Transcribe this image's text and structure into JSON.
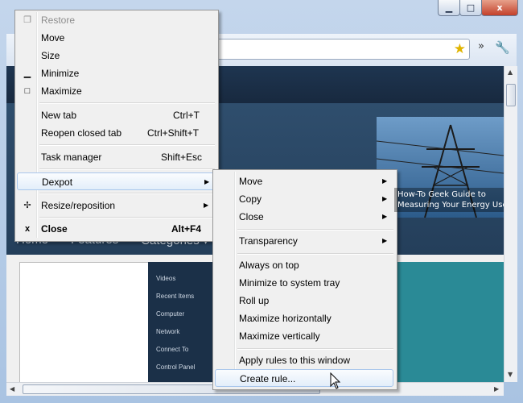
{
  "window_controls": {
    "minimize": "▁",
    "maximize": "□",
    "close": "x"
  },
  "toolbar": {
    "star": "★",
    "extensions": "»",
    "wrench": "🔧"
  },
  "site": {
    "banner_text": "How-To Geek Guide to Measuring Your Energy Use",
    "nav": [
      "Home",
      "Features",
      "Categories ▾"
    ],
    "sidebar_items": [
      "Videos",
      "Recent Items",
      "Computer",
      "Network",
      "Connect To",
      "Control Panel"
    ]
  },
  "system_menu": [
    {
      "label": "Restore",
      "shortcut": "",
      "icon": "❐",
      "disabled": true
    },
    {
      "label": "Move",
      "shortcut": ""
    },
    {
      "label": "Size",
      "shortcut": ""
    },
    {
      "label": "Minimize",
      "shortcut": "",
      "icon": "▁"
    },
    {
      "label": "Maximize",
      "shortcut": "",
      "icon": "□"
    },
    {
      "label": "New tab",
      "shortcut": "Ctrl+T"
    },
    {
      "label": "Reopen closed tab",
      "shortcut": "Ctrl+Shift+T"
    },
    {
      "label": "Task manager",
      "shortcut": "Shift+Esc"
    },
    {
      "label": "Dexpot",
      "submenu": true
    },
    {
      "label": "Resize/reposition",
      "submenu": true,
      "icon": "✢"
    },
    {
      "label": "Close",
      "shortcut": "Alt+F4",
      "icon": "x",
      "bold": true
    }
  ],
  "dexpot_menu": [
    {
      "label": "Move",
      "submenu": true
    },
    {
      "label": "Copy",
      "submenu": true
    },
    {
      "label": "Close",
      "submenu": true
    },
    {
      "label": "Transparency",
      "submenu": true
    },
    {
      "label": "Always on top"
    },
    {
      "label": "Minimize to system tray"
    },
    {
      "label": "Roll up"
    },
    {
      "label": "Maximize horizontally"
    },
    {
      "label": "Maximize vertically"
    },
    {
      "label": "Apply rules to this window"
    },
    {
      "label": "Create rule..."
    }
  ],
  "scrollbar": {
    "up": "▲",
    "down": "▼",
    "left": "◀",
    "right": "▶"
  }
}
